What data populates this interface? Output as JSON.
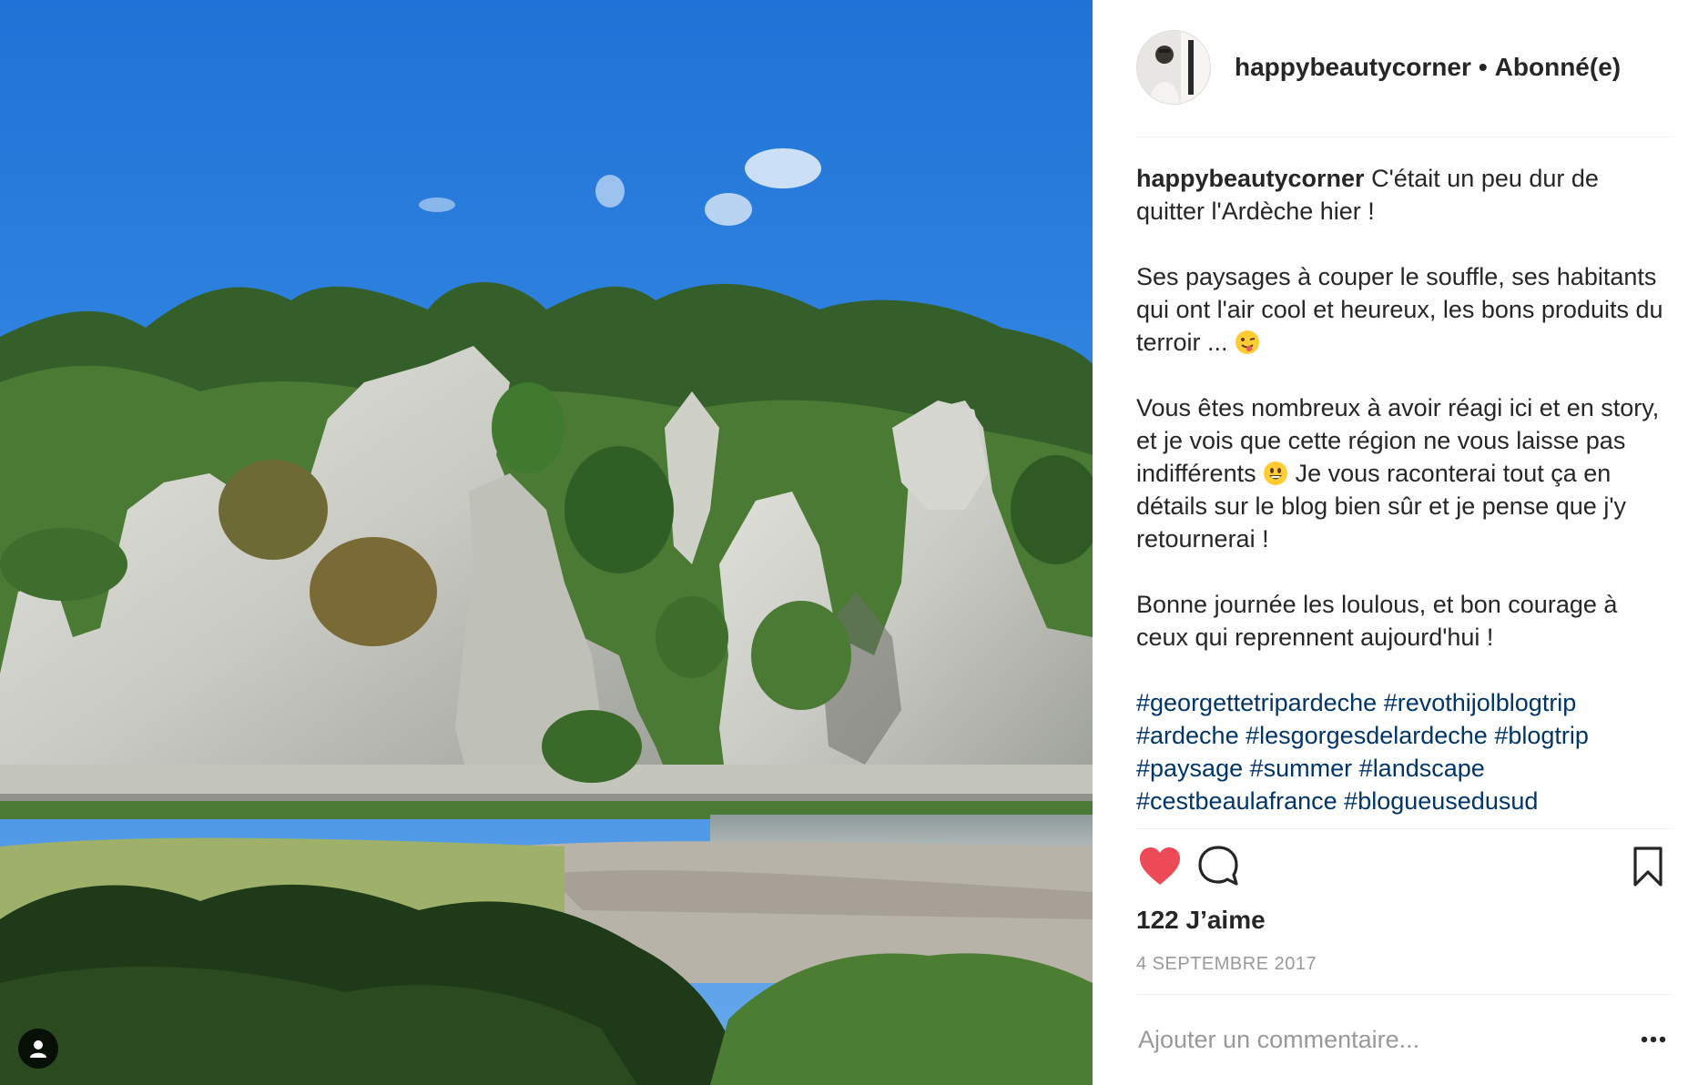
{
  "post": {
    "username": "happybeautycorner",
    "separator": "•",
    "follow_status": "Abonné(e)",
    "caption_lines": [
      "C'était un peu dur de quitter l'Ardèche hier !",
      "Ses paysages à couper le souffle, ses habitants qui ont l'air cool et heureux, les bons produits du terroir ...",
      "Vous êtes nombreux à avoir réagi ici et en story, et je vois que cette région ne vous laisse pas indifférents",
      "Je vous raconterai tout ça en détails sur le blog bien sûr et je pense que j'y retournerai !",
      "Bonne journée les loulous, et bon courage à ceux qui reprennent aujourd'hui !"
    ],
    "hashtags": [
      "#georgettetripardeche",
      "#revothijolblogtrip",
      "#ardeche",
      "#lesgorgesdelardeche",
      "#blogtrip",
      "#paysage",
      "#summer",
      "#landscape",
      "#cestbeaulafrance",
      "#blogueusedusud"
    ],
    "likes": "122 J’aime",
    "date": "4 SEPTEMBRE 2017"
  },
  "comment": {
    "placeholder": "Ajouter un commentaire..."
  },
  "icons": {
    "like": "heart-icon",
    "comment": "speech-bubble-icon",
    "save": "bookmark-icon",
    "more": "ellipsis-icon",
    "tagged": "person-icon"
  },
  "colors": {
    "like_red": "#ed4956",
    "hashtag_blue": "#003569",
    "muted": "#999999"
  }
}
